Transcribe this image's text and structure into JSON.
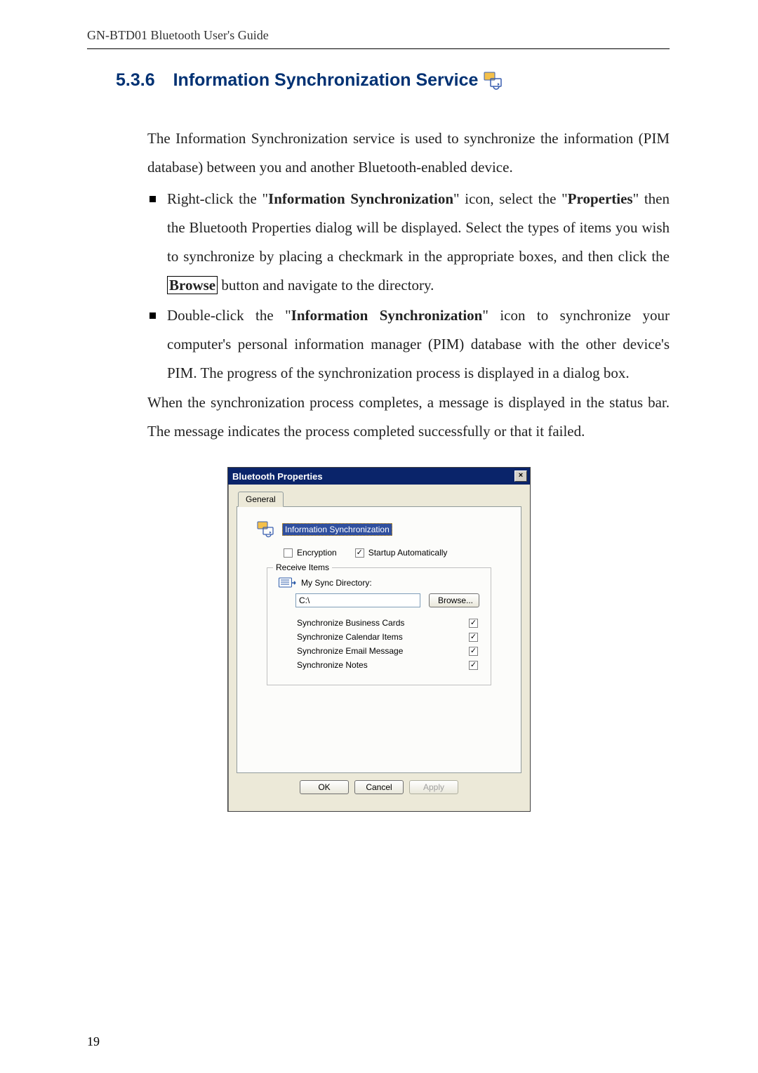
{
  "doc": {
    "header": "GN-BTD01 Bluetooth User's Guide",
    "section_number": "5.3.6",
    "section_title": "Information Synchronization Service",
    "intro": "The Information Synchronization service is used to synchronize the information (PIM database) between you and another Bluetooth-enabled device.",
    "bullet1_pre": "Right-click the \"",
    "bullet1_term": "Information Synchronization",
    "bullet1_mid": "\" icon, select the \"",
    "bullet1_term2": "Properties",
    "bullet1_rest1": "\" then the Bluetooth Properties dialog will be displayed. Select the types of items you wish to synchronize by placing a checkmark in the appropriate boxes, and then click the ",
    "bullet1_browse": "Browse",
    "bullet1_rest2": " button and navigate to the directory.",
    "bullet2_pre": "Double-click the \"",
    "bullet2_term": "Information Synchronization",
    "bullet2_rest": "\" icon to synchronize your computer's personal information manager (PIM) database with the other device's PIM. The progress of the synchronization process is displayed in a dialog box.",
    "after": "When the synchronization process completes, a message is displayed in the status bar. The message indicates the process completed successfully or that it failed.",
    "page_number": "19"
  },
  "dialog": {
    "title": "Bluetooth Properties",
    "close_glyph": "×",
    "tab": "General",
    "service_name": "Information Synchronization",
    "encryption_label": "Encryption",
    "startup_label": "Startup Automatically",
    "group_legend": "Receive Items",
    "dir_label": "My Sync Directory:",
    "path_value": "C:\\",
    "browse_label": "Browse...",
    "rows": [
      "Synchronize Business Cards",
      "Synchronize Calendar Items",
      "Synchronize Email Message",
      "Synchronize Notes"
    ],
    "buttons": {
      "ok": "OK",
      "cancel": "Cancel",
      "apply": "Apply"
    }
  }
}
